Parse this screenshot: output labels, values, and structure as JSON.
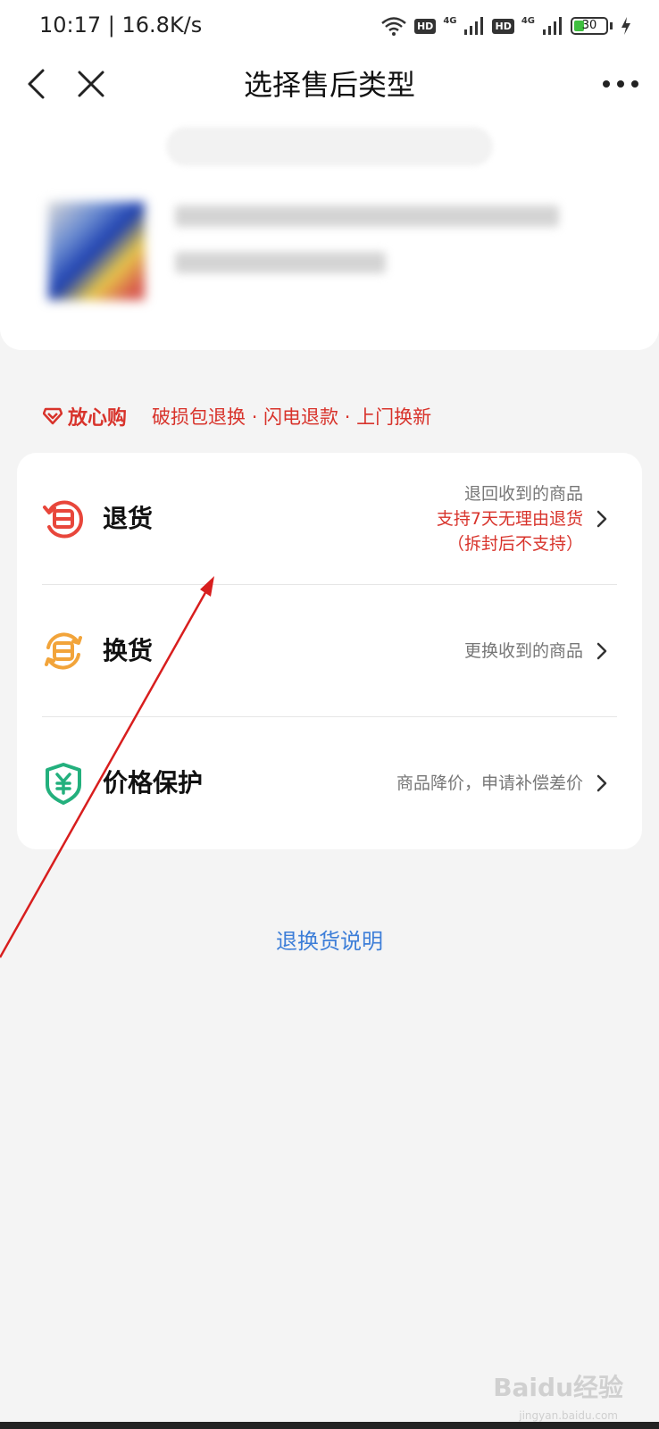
{
  "status_bar": {
    "time": "10:17 | 16.8K/s",
    "hd_label": "HD",
    "network_label": "4G",
    "battery_level": "30"
  },
  "header": {
    "title": "选择售后类型"
  },
  "guarantee": {
    "label": "放心购",
    "features": "破损包退换 · 闪电退款 · 上门换新"
  },
  "options": [
    {
      "title": "退货",
      "desc": "退回收到的商品",
      "desc_highlight": "支持7天无理由退货",
      "desc_note": "（拆封后不支持）",
      "icon": "return-icon",
      "color": "#e8463b"
    },
    {
      "title": "换货",
      "desc": "更换收到的商品",
      "icon": "exchange-icon",
      "color": "#f2a43a"
    },
    {
      "title": "价格保护",
      "desc": "商品降价，申请补偿差价",
      "icon": "price-shield-icon",
      "color": "#23b07d"
    }
  ],
  "help_link": "退换货说明",
  "watermark": "Baidu经验",
  "watermark_sub": "jingyan.baidu.com"
}
